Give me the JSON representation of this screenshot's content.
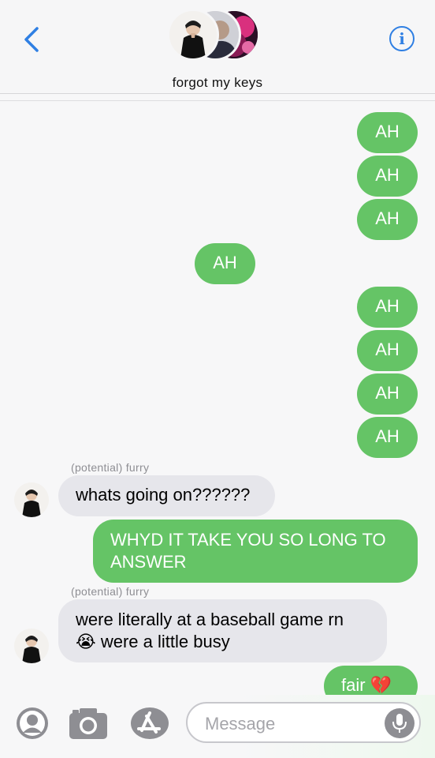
{
  "header": {
    "group_name": "forgot my keys",
    "back_icon": "chevron-left-icon",
    "info_icon": "info-icon",
    "info_glyph": "i",
    "accent": "#2f7fe3"
  },
  "colors": {
    "outgoing": "#65c466",
    "incoming": "#e6e6eb"
  },
  "messages": [
    {
      "text": "AH"
    },
    {
      "text": "AH"
    },
    {
      "text": "AH"
    },
    {
      "text": "AH"
    },
    {
      "text": "AH"
    },
    {
      "text": "AH"
    },
    {
      "text": "AH"
    },
    {
      "text": "AH"
    },
    {
      "sender": "(potential) furry",
      "text": "whats going on??????"
    },
    {
      "line1": "WHYD IT TAKE YOU SO LONG TO",
      "line2": "ANSWER"
    },
    {
      "sender": "(potential) furry",
      "line1": "were literally at a baseball game rn",
      "line2": "were a little busy",
      "emoji": "😭"
    },
    {
      "text": "fair",
      "emoji": "💔"
    }
  ],
  "composer": {
    "placeholder": "Message",
    "tools": [
      "memoji-icon",
      "camera-icon",
      "app-store-icon"
    ],
    "mic_icon": "microphone-icon"
  }
}
